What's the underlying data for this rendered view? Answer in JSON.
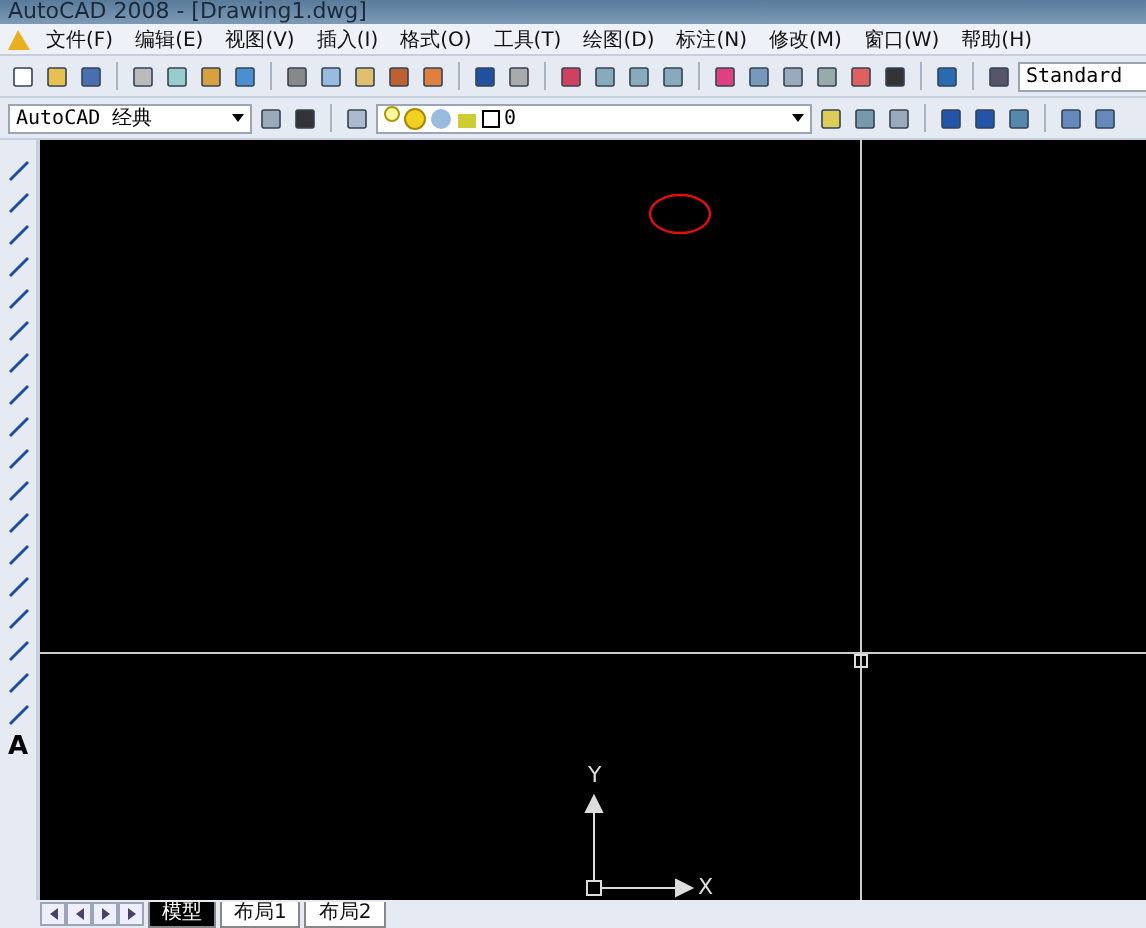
{
  "window": {
    "title": "AutoCAD 2008 - [Drawing1.dwg]"
  },
  "menu": [
    "文件(F)",
    "编辑(E)",
    "视图(V)",
    "插入(I)",
    "格式(O)",
    "工具(T)",
    "绘图(D)",
    "标注(N)",
    "修改(M)",
    "窗口(W)",
    "帮助(H)"
  ],
  "workspace": {
    "value": "AutoCAD 经典"
  },
  "layer": {
    "value": "0"
  },
  "text_style": {
    "value": "Standard"
  },
  "draw_toolbar": {
    "text_tool": "A"
  },
  "canvas": {
    "ucs_y": "Y",
    "ucs_x": "X"
  },
  "layout_tabs": [
    {
      "label": "模型",
      "selected": true
    },
    {
      "label": "布局1",
      "selected": false
    },
    {
      "label": "布局2",
      "selected": false
    }
  ]
}
